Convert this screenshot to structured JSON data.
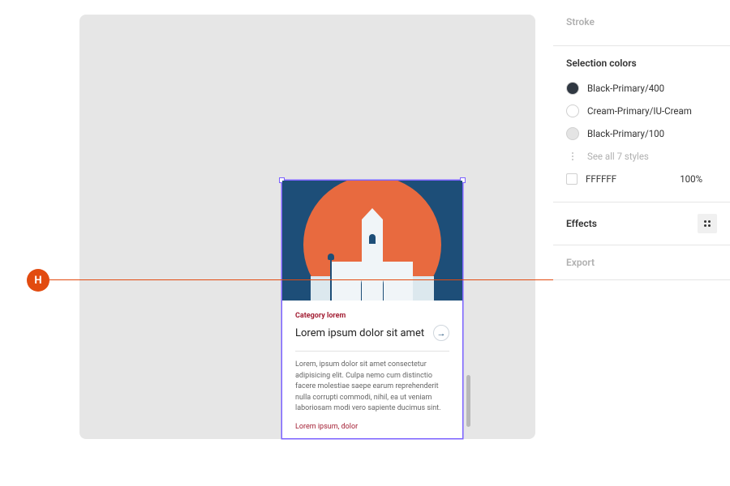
{
  "annotation": {
    "label": "H"
  },
  "sidebar": {
    "stroke": {
      "title": "Stroke"
    },
    "selection_colors": {
      "title": "Selection colors",
      "items": [
        {
          "label": "Black-Primary/400",
          "swatch": "#303842"
        },
        {
          "label": "Cream-Primary/IU-Cream",
          "swatch": "#ffffff"
        },
        {
          "label": "Black-Primary/100",
          "swatch": "#e4e4e4"
        }
      ],
      "see_all": "See all 7 styles",
      "raw_color": {
        "hex": "FFFFFF",
        "opacity": "100%",
        "swatch": "#ffffff"
      }
    },
    "effects": {
      "title": "Effects"
    },
    "export": {
      "title": "Export"
    }
  },
  "frame": {
    "category": "Category lorem",
    "title": "Lorem ipsum dolor sit amet",
    "body": "Lorem, ipsum dolor sit amet consectetur adipisicing elit. Culpa nemo cum distinctio facere molestiae saepe earum reprehenderit nulla corrupti commodi, nihil, ea ut veniam laboriosam modi vero sapiente ducimus sint.",
    "meta": "Lorem ipsum, dolor",
    "arrow_glyph": "→"
  },
  "colors": {
    "accent": "#e24b10",
    "selection": "#7b61ff",
    "hero_bg": "#1d4e78",
    "hero_circle": "#e86a3f"
  }
}
